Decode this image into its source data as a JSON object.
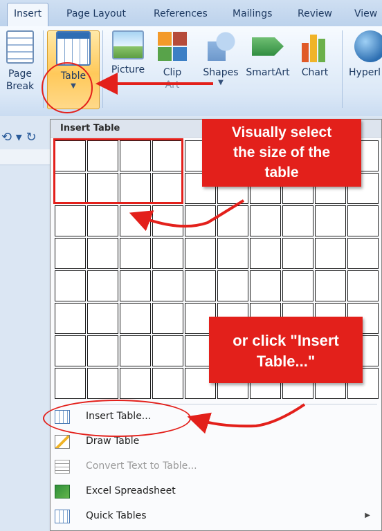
{
  "tabs": [
    "Insert",
    "Page Layout",
    "References",
    "Mailings",
    "Review",
    "View"
  ],
  "ribbon": {
    "page_break": {
      "line1": "Page",
      "line2": "Break"
    },
    "table": "Table",
    "picture": "Picture",
    "clip_art": {
      "line1": "Clip",
      "line2": "Art"
    },
    "shapes": "Shapes",
    "smartart": "SmartArt",
    "chart": "Chart",
    "hyperlink": "Hyperl"
  },
  "menu": {
    "header": "Insert Table",
    "grid": {
      "rows": 8,
      "cols": 10
    },
    "items": [
      {
        "label": "Insert Table...",
        "icon": "insert-table-icon",
        "enabled": true
      },
      {
        "label": "Draw Table",
        "icon": "draw-table-icon",
        "enabled": true
      },
      {
        "label": "Convert Text to Table...",
        "icon": "convert-text-icon",
        "enabled": false
      },
      {
        "label": "Excel Spreadsheet",
        "icon": "excel-icon",
        "enabled": true
      },
      {
        "label": "Quick Tables",
        "icon": "quick-tables-icon",
        "enabled": true,
        "submenu": true
      }
    ]
  },
  "callouts": {
    "select_size": [
      "Visually select",
      "the size of the",
      "table"
    ],
    "insert_table": [
      "or click \"Insert",
      "Table...\""
    ]
  },
  "colors": {
    "annotation_red": "#e3201b",
    "table_button_highlight": "#ffc95a"
  }
}
